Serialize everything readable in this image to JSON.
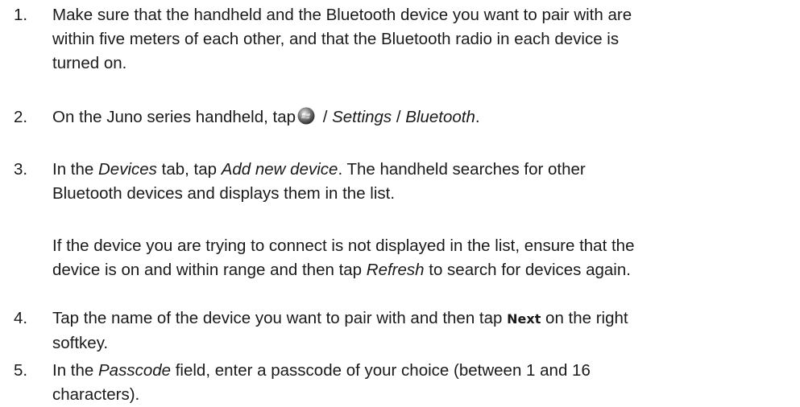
{
  "steps": [
    {
      "number": "1.",
      "lines": [
        "Make sure that the handheld and the Bluetooth device you want to pair with are",
        "within five meters of each other, and that the Bluetooth radio in each device is",
        "turned on."
      ]
    },
    {
      "number": "2.",
      "prefix": "On the Juno series handheld, tap",
      "icon": "windows-start-icon",
      "separator1": " / ",
      "settings": "Settings",
      "separator2": " / ",
      "bluetooth": "Bluetooth",
      "suffix": "."
    },
    {
      "number": "3.",
      "prefix": "In the ",
      "devices_tab": "Devices",
      "mid": " tab, tap ",
      "add_new_device": "Add new device",
      "rest_line1": ". The handheld searches for other",
      "line2": "Bluetooth devices and displays them in the list.",
      "note_line1": "If the device you are trying to connect is not displayed in the list, ensure that the",
      "note_line2_prefix": "device is on and within range and then tap ",
      "refresh": "Refresh",
      "note_line2_suffix": " to search for devices again."
    },
    {
      "number": "4.",
      "prefix": "Tap the name of the device you want to pair with and then tap ",
      "next_button": "Next",
      "suffix": " on the right",
      "line2": "softkey."
    },
    {
      "number": "5.",
      "prefix": "In the ",
      "passcode_field": "Passcode",
      "rest_line1": " field, enter a passcode of your choice (between 1 and 16",
      "line2": "characters)."
    }
  ]
}
